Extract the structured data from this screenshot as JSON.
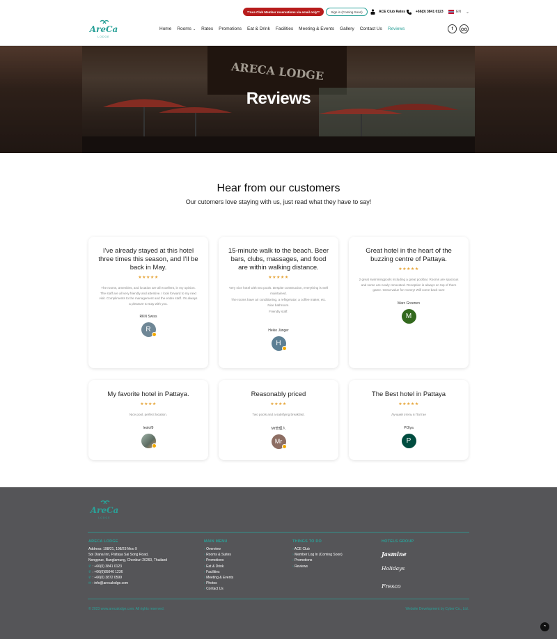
{
  "header": {
    "promo": "**Ace Club Member reservations via email only**",
    "signin": "Sign in (Coming Soon)",
    "ace_rates": "ACE Club Rates",
    "phone": "+66(0) 3841 0123",
    "lang": "EN",
    "logo_text": "AreCa",
    "logo_sub": "LODGE",
    "nav": [
      "Home",
      "Rooms",
      "Rates",
      "Promotions",
      "Eat & Drink",
      "Facilities",
      "Meeting & Events",
      "Gallery",
      "Contact Us",
      "Reviews"
    ],
    "active_nav": "Reviews"
  },
  "hero": {
    "title": "Reviews",
    "sign_text": "ARECA LODGE"
  },
  "section": {
    "title": "Hear from our customers",
    "subtitle": "Our cutomers love staying with us, just read what they have to say!"
  },
  "reviews": [
    {
      "title": "I've already stayed at this hotel three times this season, and I'll be back in May.",
      "stars": "★★★★★",
      "body": [
        "The rooms, amenities, and location are all excellent, in my opinion. The staff are all very friendly and attentive. I look forward to my next visit. Compliments to the management and the entire staff. It's always a pleasure to stay with you."
      ],
      "author": "RKN Swiss",
      "initial": "R",
      "avatar_color": "#6f8796"
    },
    {
      "title": "15-minute walk to the beach. Beer bars, clubs, massages, and food are within walking distance.",
      "stars": "★★★★★",
      "body": [
        "Very nice hotel with two pools. Despite construction, everything is well maintained.",
        "The rooms have air conditioning, a refrigerator, a coffee maker, etc. Nice bathroom.",
        "Friendly staff."
      ],
      "author": "Heiko Jünger",
      "initial": "H",
      "avatar_color": "#5c7f94"
    },
    {
      "title": "Great hotel in the heart of the buzzing centre of Pattaya.",
      "stars": "★★★★★",
      "body": [
        "2 great swimmingpools including a great poolbar. Rooms are spacious and some are newly renovated. Reception is always on top of there game. Great value for money! Will come back sure"
      ],
      "author": "Marc Groenen",
      "initial": "M",
      "avatar_color": "#33691e"
    },
    {
      "title": "My favorite hotel in Pattaya.",
      "stars": "★★★★",
      "body": [
        "Nice pool, perfect location."
      ],
      "author": "leolof9",
      "initial": "",
      "avatar_color": "#7a8a7f"
    },
    {
      "title": "Reasonably priced",
      "stars": "★★★★",
      "body": [
        "Two pools and a satisfying breakfast."
      ],
      "author": "Mr管理人",
      "initial": "Mr",
      "avatar_color": "#8d6e63"
    },
    {
      "title": "The Best hotel in Pattaya",
      "stars": "★★★★★",
      "body": [
        "Лучший отель в Паттае"
      ],
      "author": "POlya",
      "initial": "P",
      "avatar_color": "#004d40"
    }
  ],
  "footer": {
    "logo_text": "AreCa",
    "logo_sub": "LODGE",
    "about_title": "ARECA LODGE",
    "address": [
      "Address: 198/21, 198/23 Moo 9",
      "Soi Diana Inn, Pattaya Sai Song Road,",
      "Nongprue, Banglamung, Chonburi 20260, Thailand"
    ],
    "phones": [
      ": +66(0) 3841 0123",
      ": +66(0)85046 1236",
      ": +66(0) 3872 0599",
      ": info@arecalodge.com"
    ],
    "menu_title": "MAIN MENU",
    "menu": [
      "Overview",
      "Rooms & Suites",
      "Promotions",
      "Eat & Drink",
      "Facilities",
      "Meeting & Events",
      "Photos",
      "Contact Us"
    ],
    "todo_title": "THINGS TO DO",
    "todo": [
      "ACE Club",
      "Member Log In (Coming Soon)",
      "Promotions",
      "Reviews"
    ],
    "group_title": "HOTELS GROUP",
    "brands": [
      "Jasmine",
      "Holidays",
      "Fresco"
    ],
    "copyright": "© 2023 www.arecalodge.com. All rights reserved.",
    "credit": "Website Development by Cyber Co., Ltd."
  }
}
